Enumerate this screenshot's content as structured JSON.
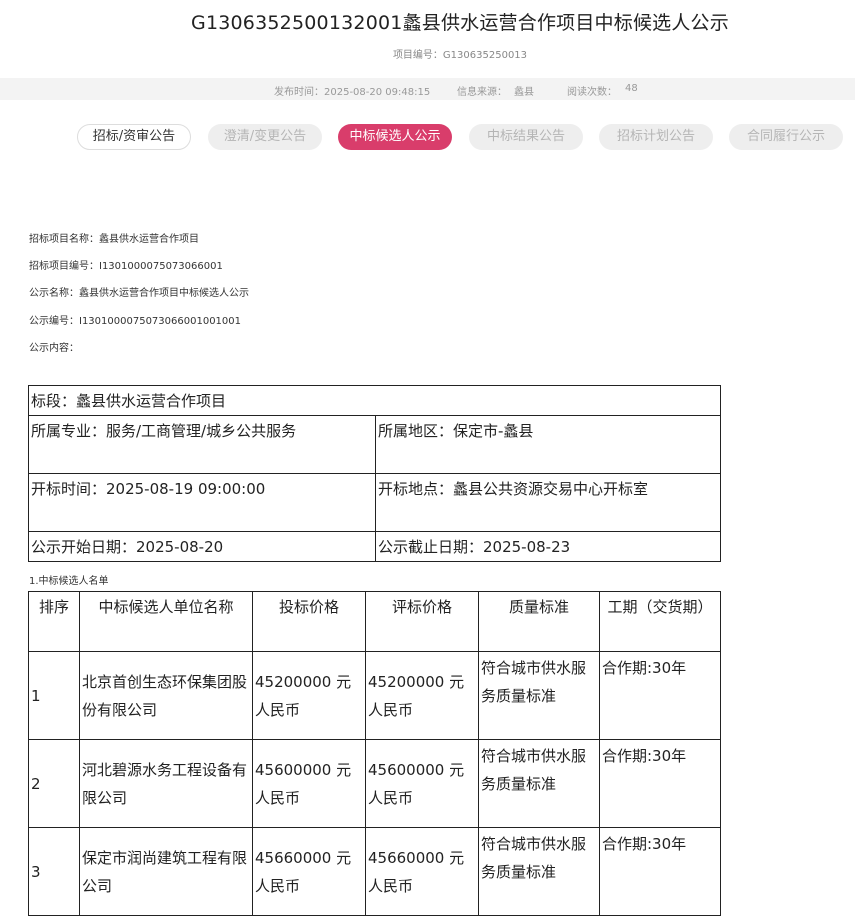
{
  "header": {
    "title": "G1306352500132001蠡县供水运营合作项目中标候选人公示",
    "project_no": "项目编号：G130635250013"
  },
  "meta": {
    "publish_time": "发布时间：2025-08-20 09:48:15",
    "source_label": "信息来源：",
    "source_value": "蠡县",
    "views_label": "阅读次数：",
    "views_value": "48"
  },
  "tabs": [
    {
      "label": "招标/资审公告"
    },
    {
      "label": "澄清/变更公告"
    },
    {
      "label": "中标候选人公示"
    },
    {
      "label": "中标结果公告"
    },
    {
      "label": "招标计划公告"
    },
    {
      "label": "合同履行公示"
    }
  ],
  "info": {
    "project_name": "招标项目名称：蠡县供水运营合作项目",
    "project_code": "招标项目编号：I1301000075073066001",
    "notice_name": "公示名称：蠡县供水运营合作项目中标候选人公示",
    "notice_code": "公示编号：I1301000075073066001001001",
    "notice_content": "公示内容："
  },
  "section": {
    "bid_section": "标段：蠡县供水运营合作项目",
    "specialty": "所属专业：服务/工商管理/城乡公共服务",
    "region": "所属地区：保定市-蠡县",
    "open_time": "开标时间：2025-08-19 09:00:00",
    "open_place": "开标地点：蠡县公共资源交易中心开标室",
    "start_date": "公示开始日期：2025-08-20",
    "end_date": "公示截止日期：2025-08-23"
  },
  "candidates": {
    "list_title": "1.中标候选人名单",
    "headers": [
      "排序",
      "中标候选人单位名称",
      "投标价格",
      "评标价格",
      "质量标准",
      "工期（交货期）"
    ],
    "rows": [
      [
        "1",
        "北京首创生态环保集团股份有限公司",
        "45200000 元人民币",
        "45200000 元人民币",
        "符合城市供水服务质量标准",
        "合作期:30年"
      ],
      [
        "2",
        "河北碧源水务工程设备有限公司",
        "45600000 元人民币",
        "45600000 元人民币",
        "符合城市供水服务质量标准",
        "合作期:30年"
      ],
      [
        "3",
        "保定市润尚建筑工程有限公司",
        "45660000 元人民币",
        "45660000 元人民币",
        "符合城市供水服务质量标准",
        "合作期:30年"
      ]
    ]
  }
}
